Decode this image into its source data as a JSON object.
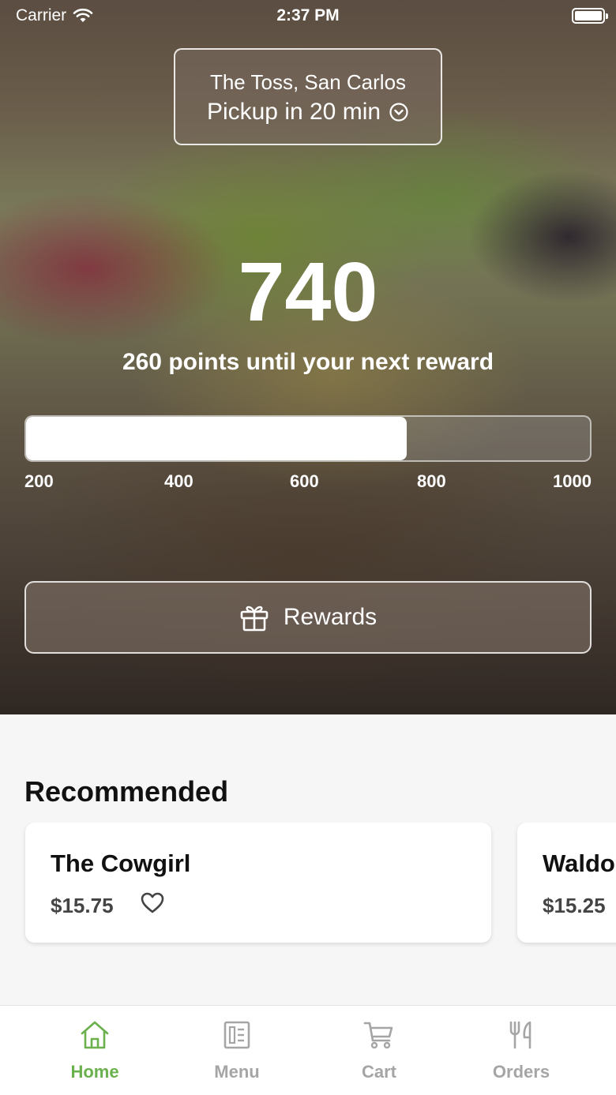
{
  "status_bar": {
    "carrier": "Carrier",
    "time": "2:37 PM"
  },
  "location": {
    "name": "The Toss, San Carlos",
    "pickup": "Pickup in 20 min"
  },
  "points": {
    "value": "740",
    "caption": "260 points until your next reward",
    "progress_value": 740,
    "progress_min": 200,
    "progress_max": 1000,
    "ticks": [
      "200",
      "400",
      "600",
      "800",
      "1000"
    ]
  },
  "rewards_button": {
    "label": "Rewards"
  },
  "recommended": {
    "title": "Recommended",
    "items": [
      {
        "name": "The Cowgirl",
        "price": "$15.75"
      },
      {
        "name": "Waldor",
        "price": "$15.25"
      }
    ]
  },
  "tabs": [
    {
      "label": "Home",
      "icon": "home-icon",
      "active": true
    },
    {
      "label": "Menu",
      "icon": "menu-icon",
      "active": false
    },
    {
      "label": "Cart",
      "icon": "cart-icon",
      "active": false
    },
    {
      "label": "Orders",
      "icon": "utensils-icon",
      "active": false
    }
  ],
  "colors": {
    "accent": "#6ab04c",
    "inactive": "#a5a5a5"
  }
}
